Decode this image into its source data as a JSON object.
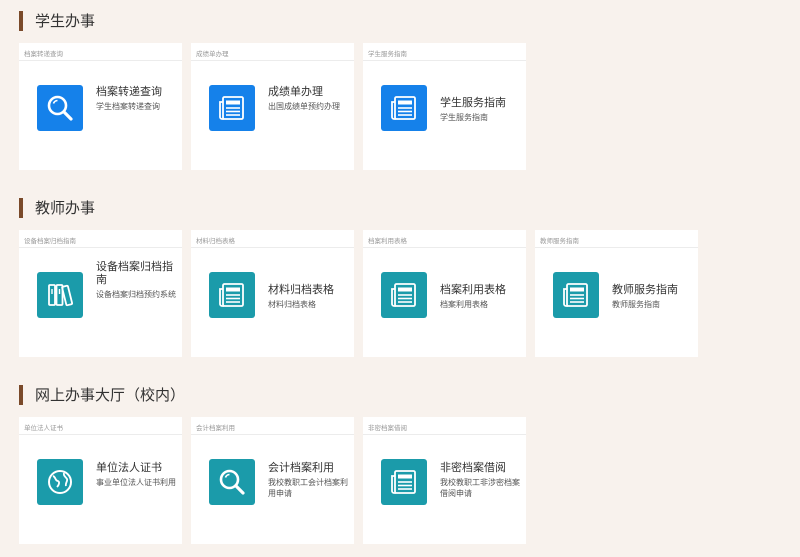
{
  "sections": [
    {
      "title": "学生办事",
      "cards": [
        {
          "header": "档案转递查询",
          "title": "档案转递查询",
          "desc": "学生档案转递查询",
          "icon": "search-icon"
        },
        {
          "header": "成绩单办理",
          "title": "成绩单办理",
          "desc": "出国成绩单预约办理",
          "icon": "newspaper-icon"
        },
        {
          "header": "学生服务指南",
          "title": "学生服务指南",
          "desc": "学生服务指南",
          "icon": "newspaper-icon"
        }
      ]
    },
    {
      "title": "教师办事",
      "cards": [
        {
          "header": "设备档案归档指南",
          "title": "设备档案归档指南",
          "desc": "设备档案归档预约系统",
          "icon": "binders-icon"
        },
        {
          "header": "材料归档表格",
          "title": "材料归档表格",
          "desc": "材料归档表格",
          "icon": "newspaper-icon"
        },
        {
          "header": "档案利用表格",
          "title": "档案利用表格",
          "desc": "档案利用表格",
          "icon": "newspaper-icon"
        },
        {
          "header": "教师服务指南",
          "title": "教师服务指南",
          "desc": "教师服务指南",
          "icon": "newspaper-icon"
        }
      ]
    },
    {
      "title": "网上办事大厅（校内）",
      "cards": [
        {
          "header": "单位法人证书",
          "title": "单位法人证书",
          "desc": "事业单位法人证书利用",
          "icon": "globe-icon"
        },
        {
          "header": "会计档案利用",
          "title": "会计档案利用",
          "desc": "我校教职工会计档案利用申请",
          "icon": "search-icon"
        },
        {
          "header": "非密档案借阅",
          "title": "非密档案借阅",
          "desc": "我校教职工非涉密档案借阅申请",
          "icon": "newspaper-icon"
        }
      ]
    }
  ],
  "colors": {
    "blue": "#1581ea",
    "teal": "#1b9baa",
    "accent": "#7a4a2a"
  }
}
